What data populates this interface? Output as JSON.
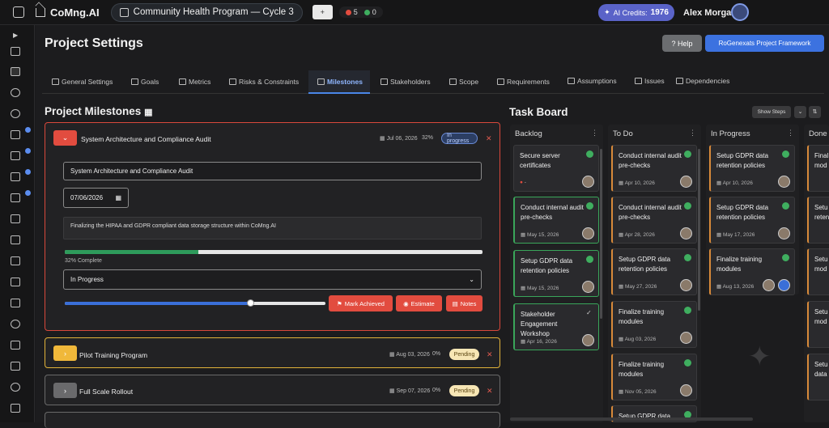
{
  "app": {
    "brand": "CoMng.AI",
    "project": "Community Health Program — Cycle 3",
    "plus": "+",
    "stat_red": "5",
    "stat_green": "0",
    "credits_label": "AI Credits:",
    "credits_value": "1976",
    "user": "Alex Morgan"
  },
  "header": {
    "title": "Project Settings",
    "help": "Help",
    "framework": "RoGenexats Project Framework"
  },
  "tabs": [
    "General Settings",
    "Goals",
    "Metrics",
    "Risks & Constraints",
    "Milestones",
    "Stakeholders",
    "Scope",
    "Requirements",
    "Assumptions",
    "Issues",
    "Dependencies"
  ],
  "milestones": {
    "title": "Project Milestones",
    "open": {
      "name": "System Architecture and Compliance Audit",
      "date": "Jul 06, 2026",
      "pct": "32%",
      "status": "In progress",
      "input_value": "System Architecture and Compliance Audit",
      "date_value": "07/06/2026",
      "description": "Finalizing the HIPAA and GDPR compliant data storage structure within CoMng.AI",
      "progress": 0.32,
      "progress_label": "32% Complete",
      "status_select": "In Progress",
      "slider_value": 0.71,
      "btn_achieved": "Mark Achieved",
      "btn_estimate": "Estimate",
      "btn_notes": "Notes"
    },
    "list": [
      {
        "name": "Pilot Training Program",
        "date": "Aug 03, 2026",
        "pct": "0%",
        "status": "Pending",
        "color": "#f0b83a"
      },
      {
        "name": "Full Scale Rollout",
        "date": "Sep 07, 2026",
        "pct": "0%",
        "status": "Pending",
        "color": "#8a8a8a"
      }
    ]
  },
  "board": {
    "title": "Task Board",
    "show_steps": "Show Steps",
    "columns": [
      {
        "name": "Backlog",
        "tasks": [
          {
            "title": "Secure server certificates",
            "date": "-"
          },
          {
            "title": "Conduct internal audit pre-checks",
            "date": "May 15, 2026"
          },
          {
            "title": "Setup GDPR data retention policies",
            "date": "May 15, 2026"
          },
          {
            "title": "Stakeholder Engagement Workshop",
            "date": "Apr 16, 2026"
          }
        ]
      },
      {
        "name": "To Do",
        "tasks": [
          {
            "title": "Conduct internal audit pre-checks",
            "date": "Apr 10, 2026"
          },
          {
            "title": "Conduct internal audit pre-checks",
            "date": "Apr 28, 2026"
          },
          {
            "title": "Setup GDPR data retention policies",
            "date": "May 27, 2026"
          },
          {
            "title": "Finalize training modules",
            "date": "Aug 03, 2026"
          },
          {
            "title": "Finalize training modules",
            "date": "Nov 05, 2026"
          },
          {
            "title": "Setup GDPR data",
            "date": ""
          }
        ]
      },
      {
        "name": "In Progress",
        "tasks": [
          {
            "title": "Setup GDPR data retention policies",
            "date": "Apr 10, 2026"
          },
          {
            "title": "Setup GDPR data retention policies",
            "date": "May 17, 2026"
          },
          {
            "title": "Finalize training modules",
            "date": "Aug 13, 2026"
          }
        ]
      },
      {
        "name": "Done",
        "tasks": [
          {
            "title": "Final mod",
            "date": ""
          },
          {
            "title": "Setu reten",
            "date": ""
          },
          {
            "title": "Setu mod",
            "date": ""
          },
          {
            "title": "Setu mod",
            "date": ""
          },
          {
            "title": "Setu data",
            "date": ""
          }
        ]
      }
    ]
  }
}
